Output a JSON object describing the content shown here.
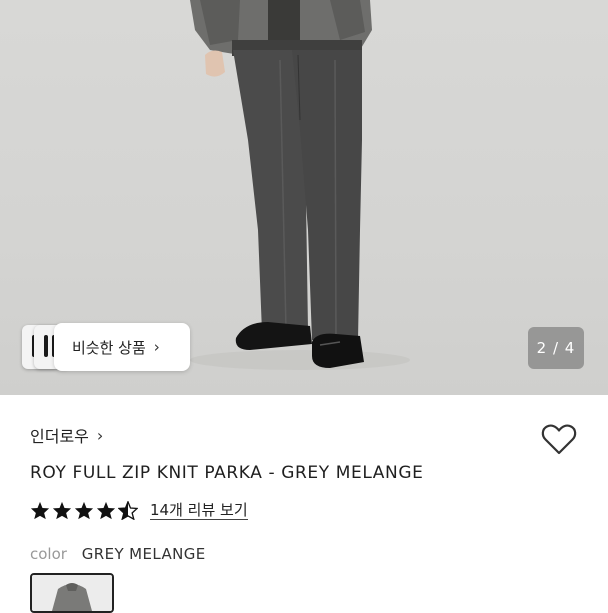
{
  "gallery": {
    "similar_button_label": "비슷한 상품",
    "similar_chevron": "›",
    "page_counter": "2 / 4"
  },
  "product": {
    "brand": "인더로우",
    "brand_chevron": "›",
    "title": "ROY FULL ZIP KNIT PARKA - GREY MELANGE",
    "rating": 4.5,
    "review_link": "14개 리뷰 보기",
    "color_label": "color",
    "color_value": "GREY MELANGE"
  },
  "colors": {
    "star": "#111111",
    "jeans": "#4b4b4b",
    "background": "#d6d6d4"
  }
}
